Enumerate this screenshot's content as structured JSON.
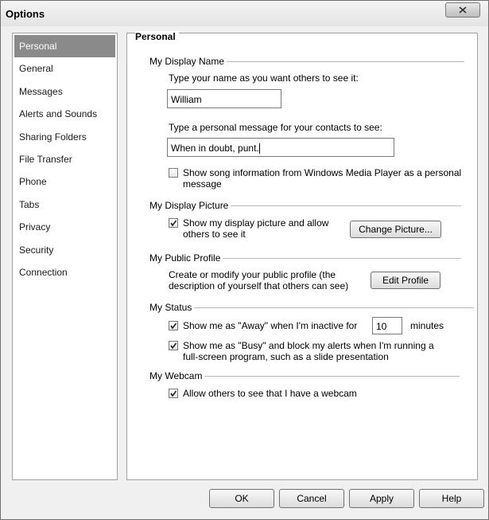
{
  "window": {
    "title": "Options"
  },
  "sidebar": {
    "items": [
      {
        "label": "Personal",
        "selected": true
      },
      {
        "label": "General"
      },
      {
        "label": "Messages"
      },
      {
        "label": "Alerts and Sounds"
      },
      {
        "label": "Sharing Folders"
      },
      {
        "label": "File Transfer"
      },
      {
        "label": "Phone"
      },
      {
        "label": "Tabs"
      },
      {
        "label": "Privacy"
      },
      {
        "label": "Security"
      },
      {
        "label": "Connection"
      }
    ]
  },
  "content": {
    "title": "Personal",
    "display_name": {
      "section": "My Display Name",
      "name_prompt": "Type your name as you want others to see it:",
      "name_value": "William",
      "message_prompt": "Type a personal message for your contacts to see:",
      "message_value": "When in doubt, punt.",
      "song_info_label_line1": "Show song information from Windows Media Player as a personal",
      "song_info_label_line2": "message",
      "song_info_checked": false
    },
    "display_picture": {
      "section": "My Display Picture",
      "show_label_line1": "Show my display picture and allow",
      "show_label_line2": "others to see it",
      "show_checked": true,
      "change_button": "Change Picture..."
    },
    "public_profile": {
      "section": "My Public Profile",
      "desc_line1": "Create or modify your public profile (the",
      "desc_line2": "description of yourself that others can see)",
      "edit_button": "Edit Profile"
    },
    "status": {
      "section": "My Status",
      "away_label": "Show me as \"Away\" when I'm inactive for",
      "away_checked": true,
      "away_minutes": "10",
      "minutes_label": "minutes",
      "busy_label_line1": "Show me as \"Busy\" and block my alerts when I'm running a",
      "busy_label_line2": "full-screen program, such as a slide presentation",
      "busy_checked": true
    },
    "webcam": {
      "section": "My Webcam",
      "allow_label": "Allow others to see that I have a webcam",
      "allow_checked": true
    }
  },
  "footer": {
    "ok": "OK",
    "cancel": "Cancel",
    "apply": "Apply",
    "help": "Help"
  },
  "icons": {
    "close": "close-icon",
    "check": "checkmark-icon"
  }
}
